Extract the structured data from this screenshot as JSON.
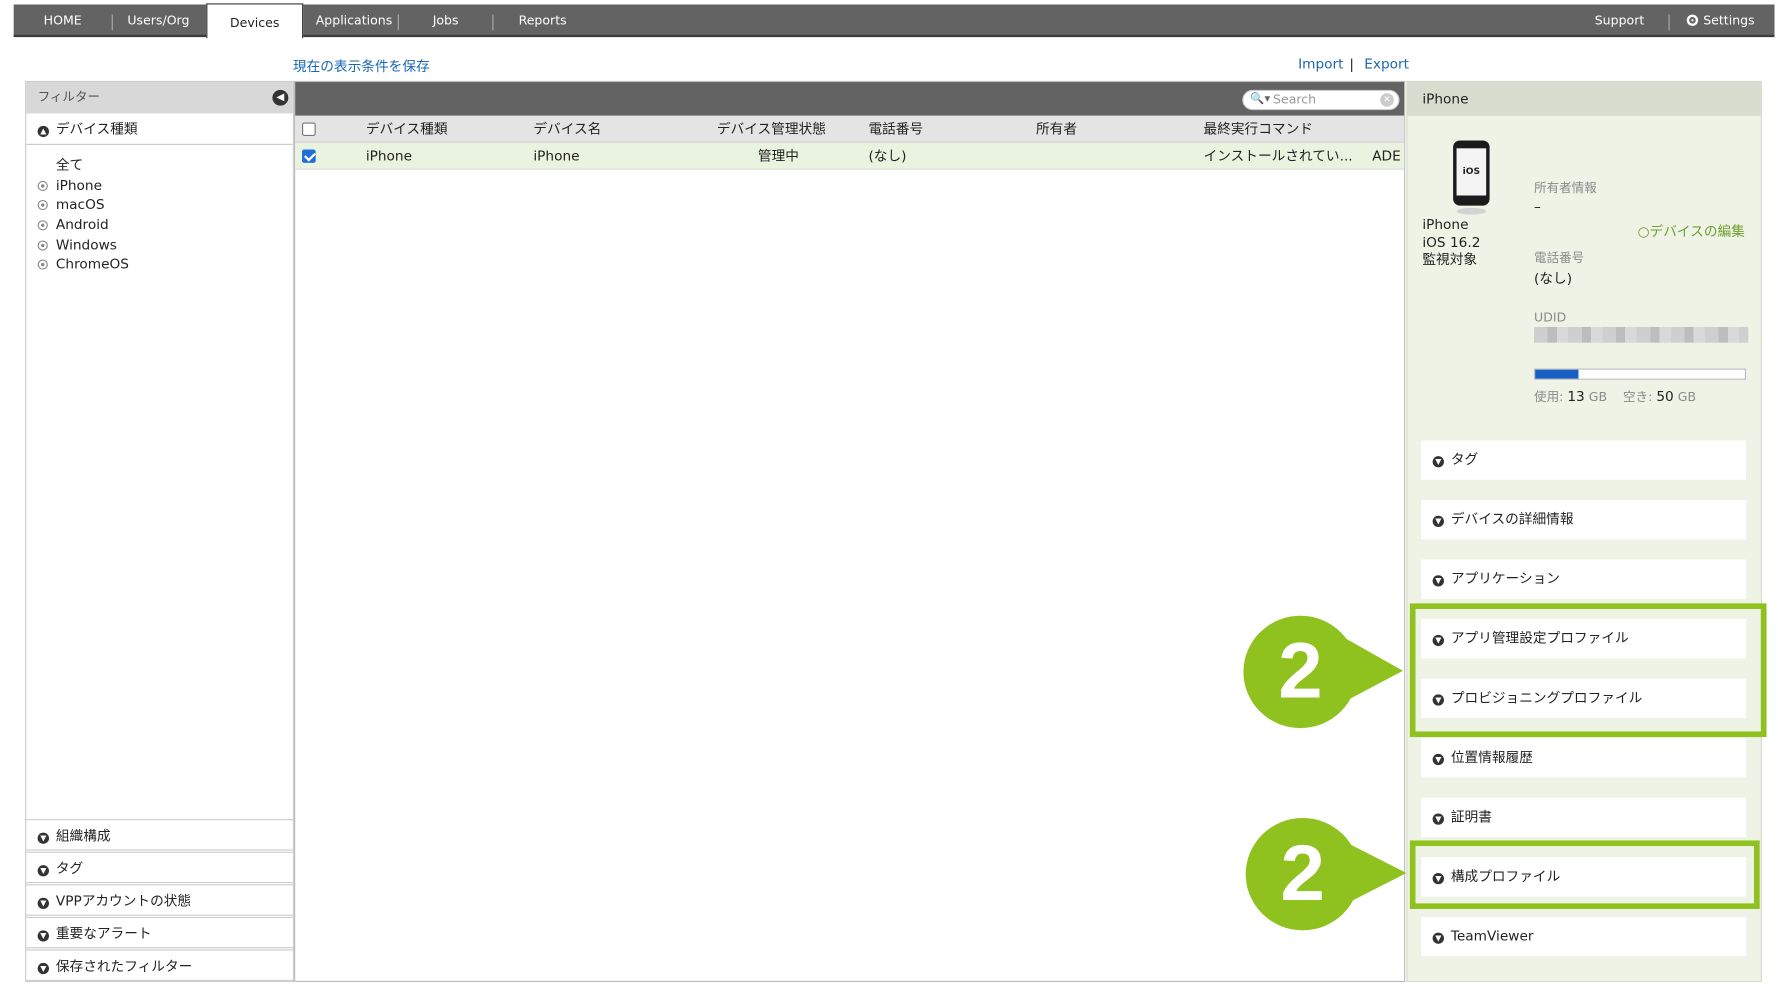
{
  "nav": {
    "tabs": [
      {
        "label": "HOME"
      },
      {
        "label": "Users/Org"
      },
      {
        "label": "Devices"
      },
      {
        "label": "Applications"
      },
      {
        "label": "Jobs"
      },
      {
        "label": "Reports"
      }
    ],
    "support": "Support",
    "settings": "Settings"
  },
  "toolbar": {
    "save_view": "現在の表示条件を保存",
    "import": "Import",
    "separator": "|",
    "export": "Export"
  },
  "filter": {
    "title": "フィルター",
    "device_type_header": "デバイス種類",
    "device_types": [
      "全て",
      "iPhone",
      "macOS",
      "Android",
      "Windows",
      "ChromeOS"
    ],
    "sections": [
      "組織構成",
      "タグ",
      "VPPアカウントの状態",
      "重要なアラート",
      "保存されたフィルター"
    ]
  },
  "table": {
    "search_placeholder": "Search",
    "columns": [
      "デバイス種類",
      "デバイス名",
      "デバイス管理状態",
      "電話番号",
      "所有者",
      "最終実行コマンド"
    ],
    "rows": [
      {
        "checked": true,
        "device_type": "iPhone",
        "device_name": "iPhone",
        "status": "管理中",
        "phone": "(なし)",
        "owner": "",
        "last_command": "インストールされてい...",
        "enrollment": "ADE"
      }
    ]
  },
  "detail": {
    "title": "iPhone",
    "icon_text": "iOS",
    "model": "iPhone",
    "os": "iOS 16.2",
    "supervised": "監視対象",
    "owner_label": "所有者情報",
    "owner_value": "–",
    "edit_link": "デバイスの編集",
    "phone_label": "電話番号",
    "phone_value": "(なし)",
    "udid_label": "UDID",
    "storage": {
      "used_label": "使用:",
      "used_value": "13",
      "used_unit": "GB",
      "free_label": "空き:",
      "free_value": "50",
      "free_unit": "GB",
      "used_fraction": 0.206
    },
    "accordions": [
      "タグ",
      "デバイスの詳細情報",
      "アプリケーション",
      "アプリ管理設定プロファイル",
      "プロビジョニングプロファイル",
      "位置情報履歴",
      "証明書",
      "構成プロファイル",
      "TeamViewer"
    ]
  },
  "callouts": [
    {
      "label": "2"
    },
    {
      "label": "2"
    }
  ],
  "colors": {
    "callout_green": "#8fc21f",
    "nav_bg": "#636363",
    "selected_row": "#eaf3df",
    "detail_bg": "#eef3e6",
    "link_blue": "#1a66b3",
    "storage_bar": "#1a5fc4"
  }
}
